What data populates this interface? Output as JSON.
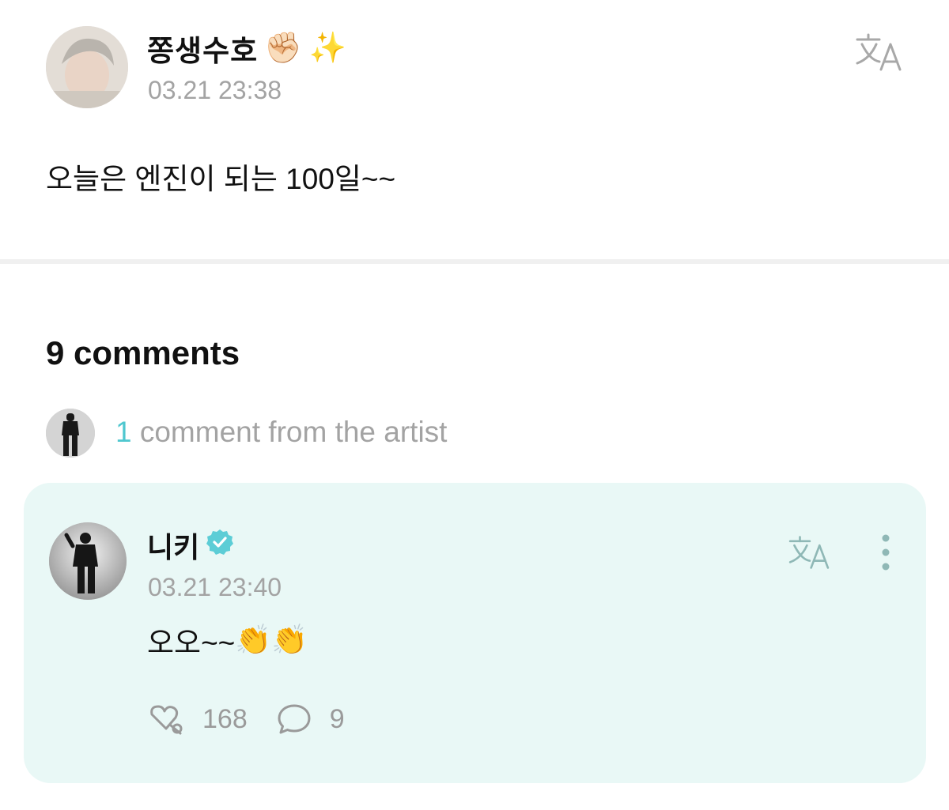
{
  "post": {
    "author": "쫑생수호",
    "author_emojis": [
      "✊🏻",
      "✨"
    ],
    "time": "03.21 23:38",
    "text": "오늘은 엔진이 되는 100일~~"
  },
  "comments": {
    "title": "9 comments",
    "artist_count": "1",
    "artist_label": " comment from the artist"
  },
  "artist_comment": {
    "author": "니키",
    "time": "03.21 23:40",
    "text": "오오~~",
    "text_emojis": "👏👏",
    "likes": "168",
    "replies": "9"
  },
  "colors": {
    "accent": "#4fc7cf",
    "card_bg": "#e9f8f6",
    "muted_text": "#a3a3a3"
  },
  "icons": [
    "translate-icon",
    "verified-badge-icon",
    "more-options-icon",
    "like-icon",
    "reply-bubble-icon"
  ]
}
